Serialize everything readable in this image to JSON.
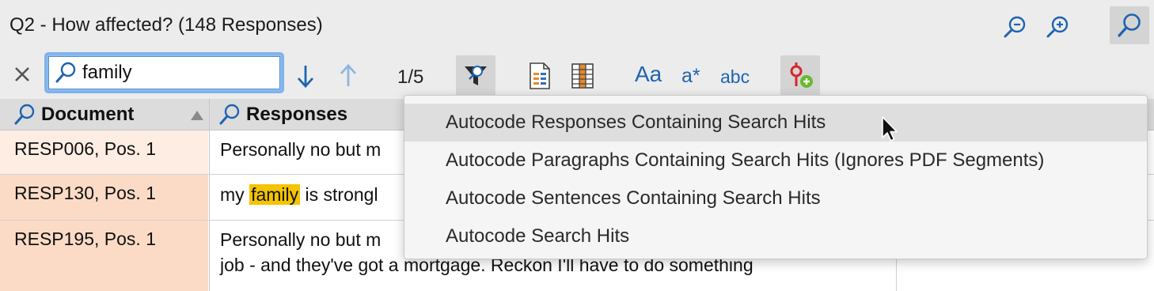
{
  "header": {
    "title": "Q2 - How affected? (148 Responses)",
    "icons": [
      "zoom-out-icon",
      "zoom-in-icon",
      "search-icon"
    ]
  },
  "toolbar": {
    "search_value": "family",
    "counter": "1/5",
    "case_label": "Aa",
    "wildcard_label": "a*",
    "word_label": "abc",
    "icons": [
      "close-icon",
      "search-icon",
      "arrow-down-icon",
      "arrow-up-icon",
      "filter-icon",
      "document-grid-icon",
      "table-grid-icon",
      "autocode-icon"
    ]
  },
  "table": {
    "columns": [
      {
        "label": "Document",
        "sort": "ascending"
      },
      {
        "label": "Responses"
      }
    ],
    "rows": [
      {
        "document": "RESP006, Pos. 1",
        "response_line1": "Personally no but m",
        "selected": false
      },
      {
        "document": "RESP130, Pos. 1",
        "response_before": "my ",
        "response_hit": "family",
        "response_after": " is strongl",
        "selected": true
      },
      {
        "document": "RESP195, Pos. 1",
        "response_line1": "Personally no but m",
        "response_line2": "job - and they've got a mortgage. Reckon I'll have to do something",
        "selected": true
      }
    ]
  },
  "menu": {
    "items": [
      "Autocode Responses Containing Search Hits",
      "Autocode Paragraphs Containing Search Hits (Ignores PDF Segments)",
      "Autocode Sentences Containing Search Hits",
      "Autocode Search Hits"
    ],
    "hovered_index": 0
  },
  "colors": {
    "accent": "#1e64b0",
    "highlight": "#f5c400",
    "row_selected": "#fcdbc6",
    "row_normal": "#fdede3",
    "focus_ring": "#7fb2ea",
    "autocode_green": "#6bb82e",
    "autocode_red": "#d8262c"
  }
}
